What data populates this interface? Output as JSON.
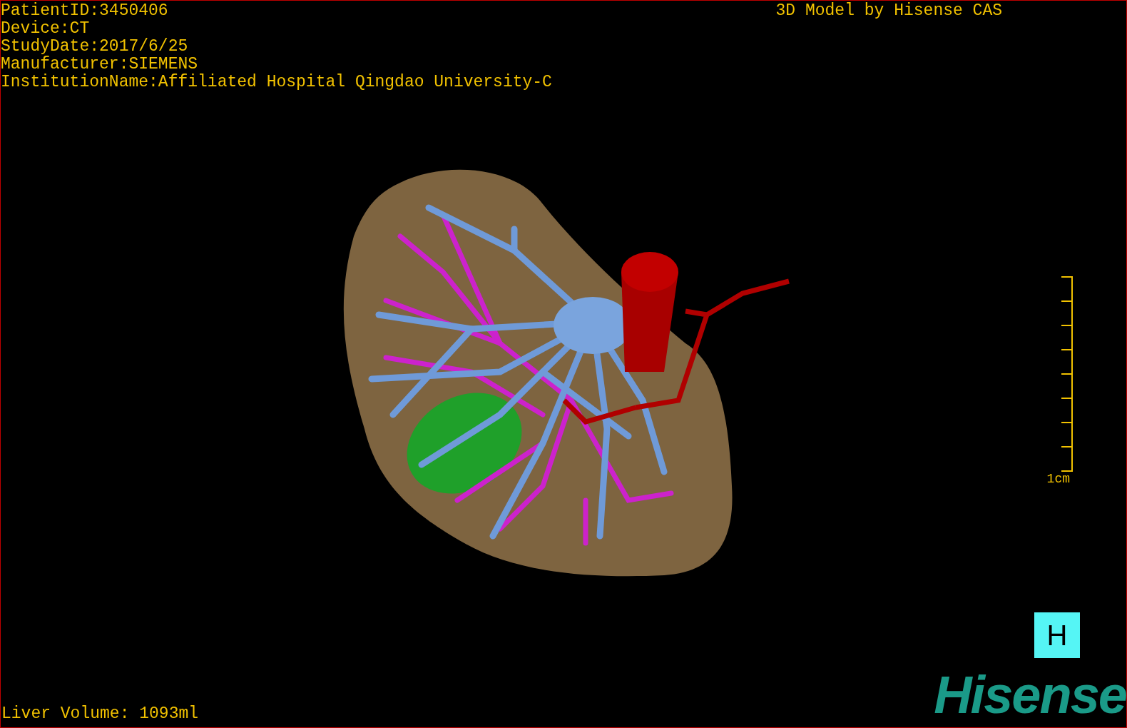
{
  "info_lines": [
    "PatientID:3450406",
    "Device:CT",
    "StudyDate:2017/6/25",
    "Manufacturer:SIEMENS",
    "InstitutionName:Affiliated Hospital Qingdao University-C"
  ],
  "title": "3D Model by Hisense CAS",
  "scale_bar": {
    "label": "1cm"
  },
  "view_button": "H",
  "liver_volume": "Liver Volume: 1093ml",
  "logo": "Hisense"
}
